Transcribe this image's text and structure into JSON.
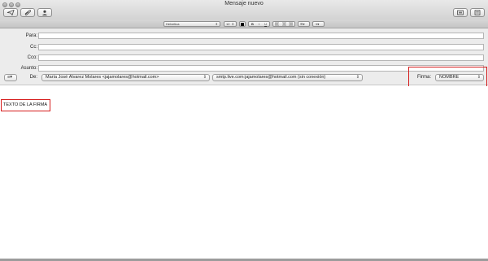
{
  "window": {
    "title": "Mensaje nuevo"
  },
  "toolbar": {
    "buttons": [
      {
        "name": "send-icon"
      },
      {
        "name": "paperclip-icon"
      },
      {
        "name": "contact-icon"
      },
      {
        "name": "photo-browser-icon"
      },
      {
        "name": "stationery-icon"
      }
    ]
  },
  "format": {
    "font": "Helvetica",
    "size": "12",
    "bold": "B",
    "italic": "I",
    "underline": "U"
  },
  "header": {
    "to_label": "Para:",
    "cc_label": "Cc:",
    "bcc_label": "Cco:",
    "subject_label": "Asunto:",
    "from_label": "De:",
    "from_value": "María José Álvarez Molares <jajamolares@hotmail.com>",
    "smtp_value": "smtp.live.com:jajamolares@hotmail.com (sin conexión)",
    "signature_label": "Firma:",
    "signature_value": "NOMBRE",
    "to_value": "",
    "cc_value": "",
    "bcc_value": "",
    "subject_value": ""
  },
  "body": {
    "text": "TEXTO DE LA FIRMA"
  },
  "colors": {
    "highlight": "#d61d1d"
  }
}
